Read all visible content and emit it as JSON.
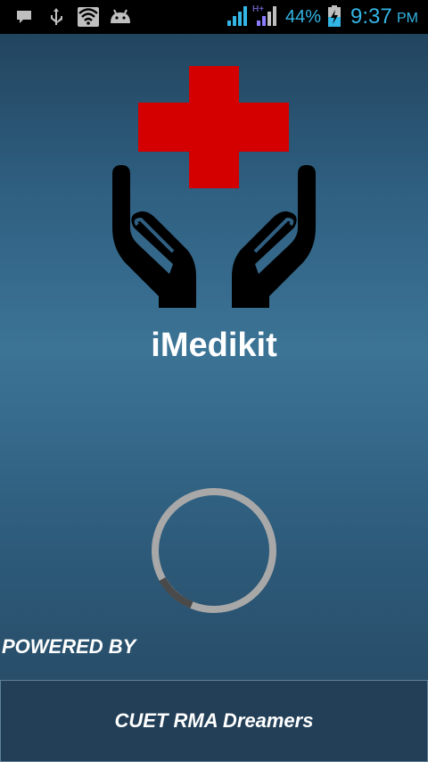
{
  "status_bar": {
    "icons": [
      "message-icon",
      "usb-icon",
      "wifi-icon",
      "android-debug-icon",
      "signal-icon",
      "signal-hplus-icon",
      "battery-charging-icon"
    ],
    "network_type": "H+",
    "battery_percent": "44%",
    "time": "9:37",
    "am_pm": "PM",
    "accent_color": "#33b5e5"
  },
  "splash": {
    "logo": "hands-holding-red-cross",
    "logo_cross_color": "#d40000",
    "app_name": "iMedikit",
    "loading_indicator": "progress-spinner"
  },
  "footer": {
    "powered_by_label": "POWERED BY",
    "credit_button_label": "CUET RMA Dreamers"
  }
}
